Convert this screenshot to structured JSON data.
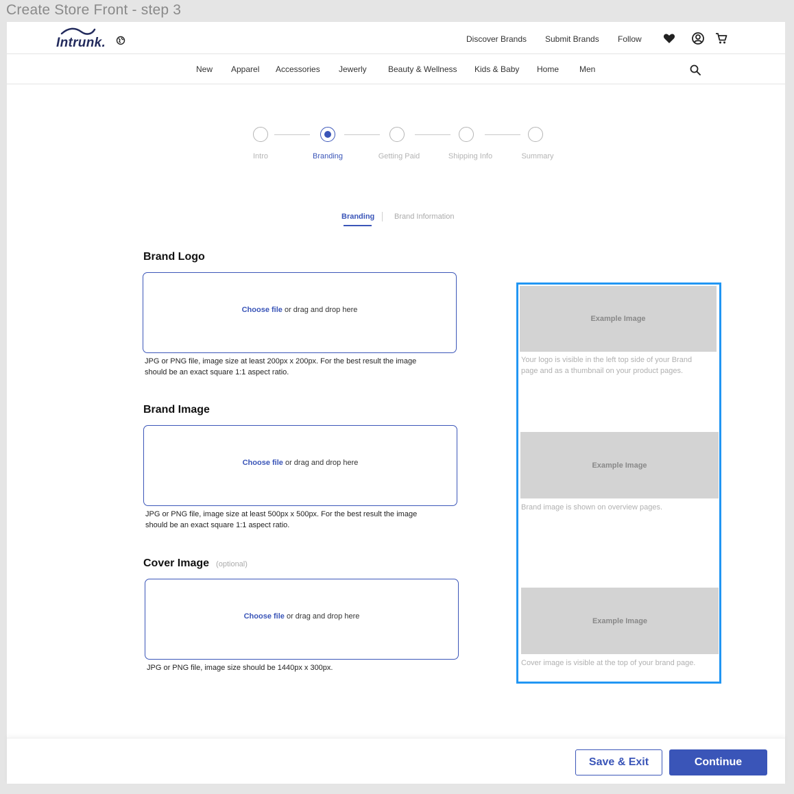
{
  "frame_title": "Create Store Front - step 3",
  "header": {
    "logo_text": "Intrunk.",
    "links": [
      "Discover Brands",
      "Submit Brands",
      "Follow"
    ]
  },
  "nav": [
    "New",
    "Apparel",
    "Accessories",
    "Jewerly",
    "Beauty & Wellness",
    "Kids & Baby",
    "Home",
    "Men"
  ],
  "stepper": {
    "steps": [
      "Intro",
      "Branding",
      "Getting Paid",
      "Shipping Info",
      "Summary"
    ],
    "active_index": 1
  },
  "subtabs": {
    "active": "Branding",
    "inactive": "Brand Information"
  },
  "sections": [
    {
      "title": "Brand Logo",
      "optional": "",
      "choose_label": "Choose file",
      "drop_label": " or drag and drop here",
      "help_line1": "JPG or PNG file, image size at least 200px x 200px. For the best result the image",
      "help_line2": "should be an exact square 1:1 aspect ratio."
    },
    {
      "title": "Brand Image",
      "optional": "",
      "choose_label": "Choose file",
      "drop_label": " or drag and drop here",
      "help_line1": "JPG or PNG file, image size at least 500px x 500px. For the best result the image",
      "help_line2": "should be an exact square 1:1 aspect ratio."
    },
    {
      "title": "Cover Image",
      "optional": "(optional)",
      "choose_label": "Choose file",
      "drop_label": " or drag and drop here",
      "help_line1": "JPG or PNG file, image size should be 1440px x 300px.",
      "help_line2": ""
    }
  ],
  "examples": [
    {
      "label": "Example Image",
      "caption_line1": "Your logo is visible in the left top side  of your Brand",
      "caption_line2": "page and as a thumbnail on your product pages."
    },
    {
      "label": "Example Image",
      "caption_line1": "Brand image is shown on overview pages.",
      "caption_line2": ""
    },
    {
      "label": "Example Image",
      "caption_line1": "Cover image is visible at the top of your brand page.",
      "caption_line2": ""
    }
  ],
  "footer": {
    "save_exit_label": "Save & Exit",
    "continue_label": "Continue"
  },
  "colors": {
    "accent": "#3a55b8",
    "highlight_border": "#2196f3",
    "placeholder_gray": "#d3d3d3"
  }
}
